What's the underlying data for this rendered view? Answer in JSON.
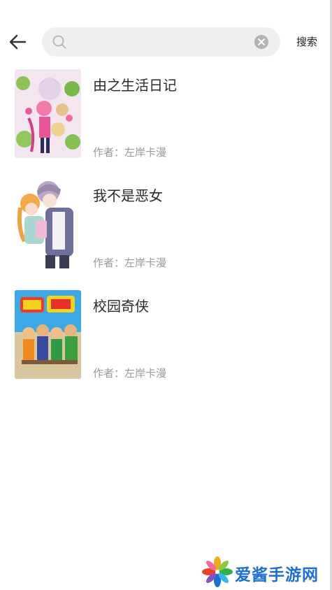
{
  "search": {
    "value": "",
    "placeholder": "",
    "button_label": "搜索"
  },
  "results": [
    {
      "title": "由之生活日记",
      "author": "作者：左岸卡漫",
      "cover_icon": "manga-cover-flowers"
    },
    {
      "title": "我不是恶女",
      "author": "作者：左岸卡漫",
      "cover_icon": "manga-cover-couple"
    },
    {
      "title": "校园奇侠",
      "author": "作者：左岸卡漫",
      "cover_icon": "manga-cover-heroes"
    }
  ],
  "watermark": {
    "text": "爱酱手游网"
  },
  "colors": {
    "search_bg": "#efefef",
    "author_text": "#9a9a9a",
    "watermark_blue": "#1d6fd0"
  }
}
